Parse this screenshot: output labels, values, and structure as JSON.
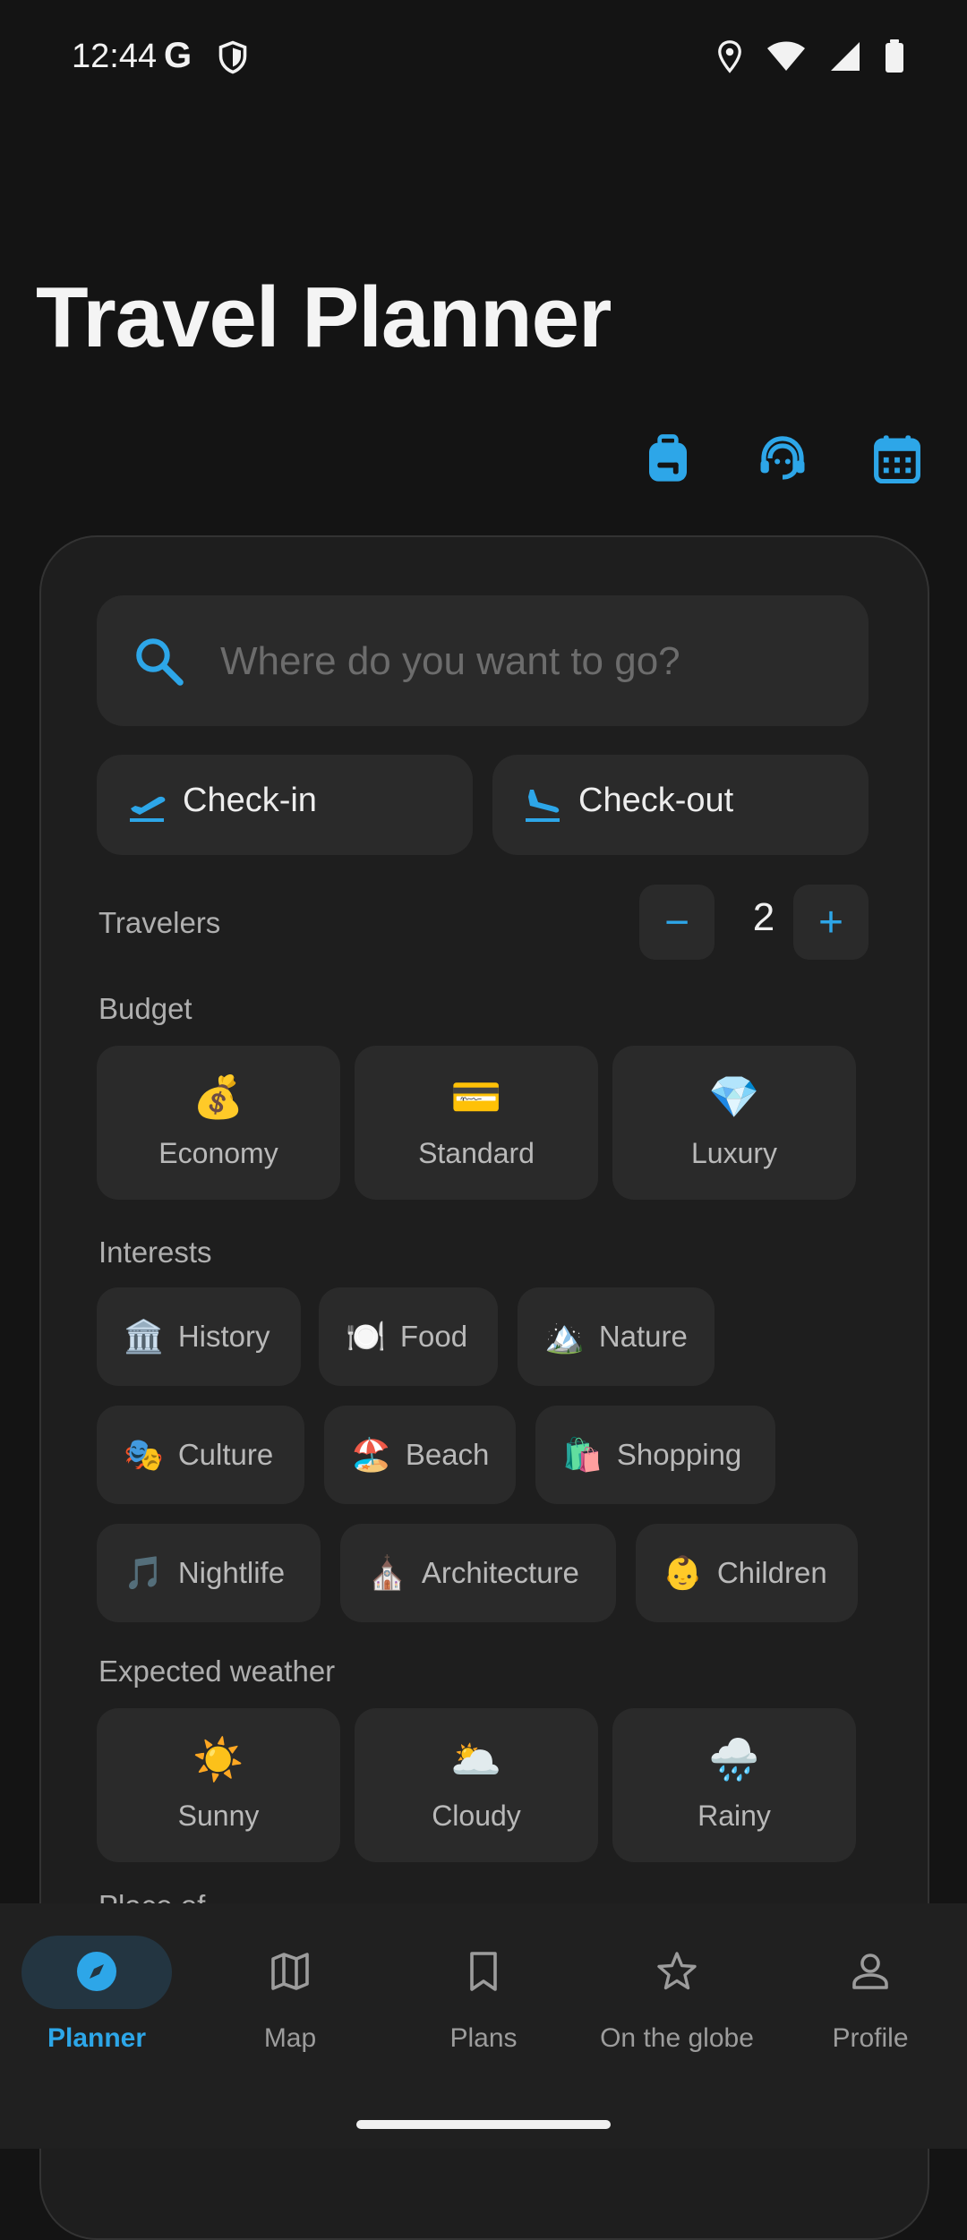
{
  "status_bar": {
    "time": "12:44",
    "g_glyph": "G"
  },
  "app": {
    "title": "Travel Planner"
  },
  "top_actions": [
    {
      "icon": "backpack-icon"
    },
    {
      "icon": "support-agent-icon"
    },
    {
      "icon": "calendar-icon"
    }
  ],
  "search": {
    "placeholder": "Where do you want to go?",
    "value": ""
  },
  "dates": {
    "checkin_label": "Check-in",
    "checkout_label": "Check-out"
  },
  "travelers": {
    "label": "Travelers",
    "count": "2",
    "minus": "−",
    "plus": "+"
  },
  "budget": {
    "label": "Budget",
    "options": [
      {
        "emoji": "💰",
        "label": "Economy"
      },
      {
        "emoji": "💳",
        "label": "Standard"
      },
      {
        "emoji": "💎",
        "label": "Luxury"
      }
    ]
  },
  "interests": {
    "label": "Interests",
    "items": [
      {
        "emoji": "🏛️",
        "label": "History"
      },
      {
        "emoji": "🍽️",
        "label": "Food"
      },
      {
        "emoji": "🏔️",
        "label": "Nature"
      },
      {
        "emoji": "🎭",
        "label": "Culture"
      },
      {
        "emoji": "🏖️",
        "label": "Beach"
      },
      {
        "emoji": "🛍️",
        "label": "Shopping"
      },
      {
        "emoji": "🎵",
        "label": "Nightlife"
      },
      {
        "emoji": "⛪",
        "label": "Architecture"
      },
      {
        "emoji": "👶",
        "label": "Children"
      }
    ]
  },
  "weather": {
    "label": "Expected weather",
    "options": [
      {
        "emoji": "☀️",
        "label": "Sunny"
      },
      {
        "emoji": "🌥️",
        "label": "Cloudy"
      },
      {
        "emoji": "🌧️",
        "label": "Rainy"
      }
    ]
  },
  "next_section_partial": "Place of",
  "bottom_nav": [
    {
      "label": "Planner",
      "icon": "compass-icon",
      "active": true
    },
    {
      "label": "Map",
      "icon": "map-icon"
    },
    {
      "label": "Plans",
      "icon": "bookmark-icon"
    },
    {
      "label": "On the globe",
      "icon": "star-icon"
    },
    {
      "label": "Profile",
      "icon": "person-icon"
    }
  ],
  "colors": {
    "accent": "#2DA6E8",
    "background": "#141414",
    "card": "#1E1E1E",
    "surface": "#2A2A2A"
  }
}
